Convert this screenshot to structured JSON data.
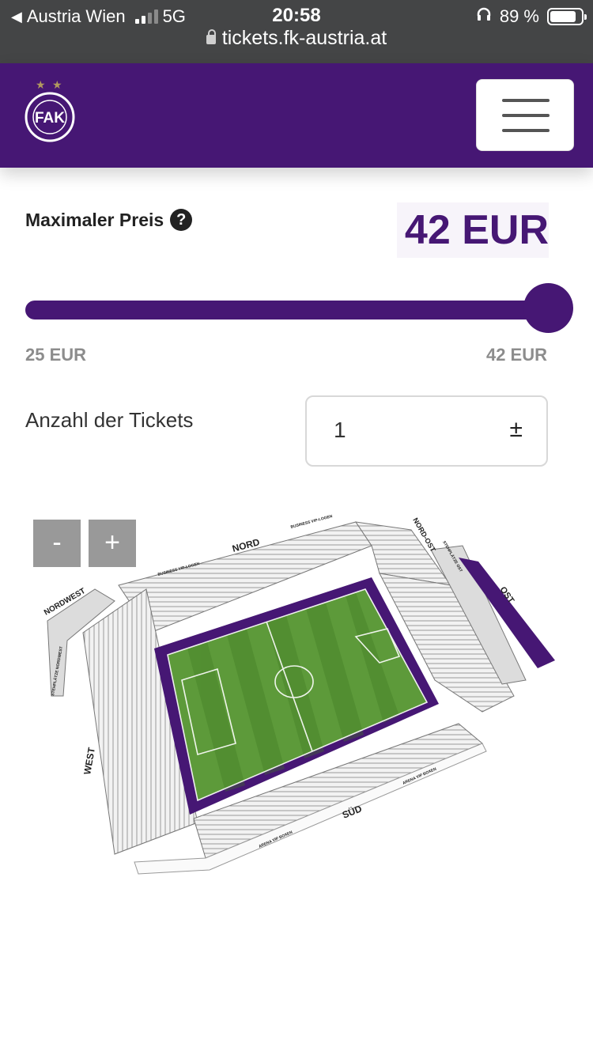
{
  "status_bar": {
    "carrier": "Austria Wien",
    "network": "5G",
    "time": "20:58",
    "battery": "89 %",
    "url": "tickets.fk-austria.at"
  },
  "header": {
    "logo_text": "FAK",
    "brand_color": "#461774"
  },
  "price": {
    "label": "Maximaler Preis",
    "help_symbol": "?",
    "value": "42 EUR",
    "min_label": "25 EUR",
    "max_label": "42 EUR",
    "slider_fraction": 1.0
  },
  "tickets": {
    "label": "Anzahl der Tickets",
    "value": "1",
    "stepper_symbol": "±"
  },
  "map": {
    "zoom_out": "-",
    "zoom_in": "+",
    "sections": {
      "nord": "NORD",
      "nordwest": "NORDWEST",
      "west": "WEST",
      "sued": "SÜD",
      "ost": "OST",
      "nord_ost": "NORD-OST",
      "business_vip_logen_1": "BUSINESS VIP-LOGEN",
      "business_vip_logen_2": "BUSINESS VIP-LOGEN",
      "arena_vip_boxen_1": "ARENA VIP BOXEN",
      "arena_vip_boxen_2": "ARENA VIP BOXEN",
      "stehplaetze_nordwest": "STEHPLÄTZE NORDWEST",
      "stehplaetze_ost": "STEHPLÄTZE OST"
    },
    "colors": {
      "pitch": "#5d9a3a",
      "pitch_dark": "#4f8a30",
      "border": "#461774",
      "ost_block": "#461774"
    }
  }
}
